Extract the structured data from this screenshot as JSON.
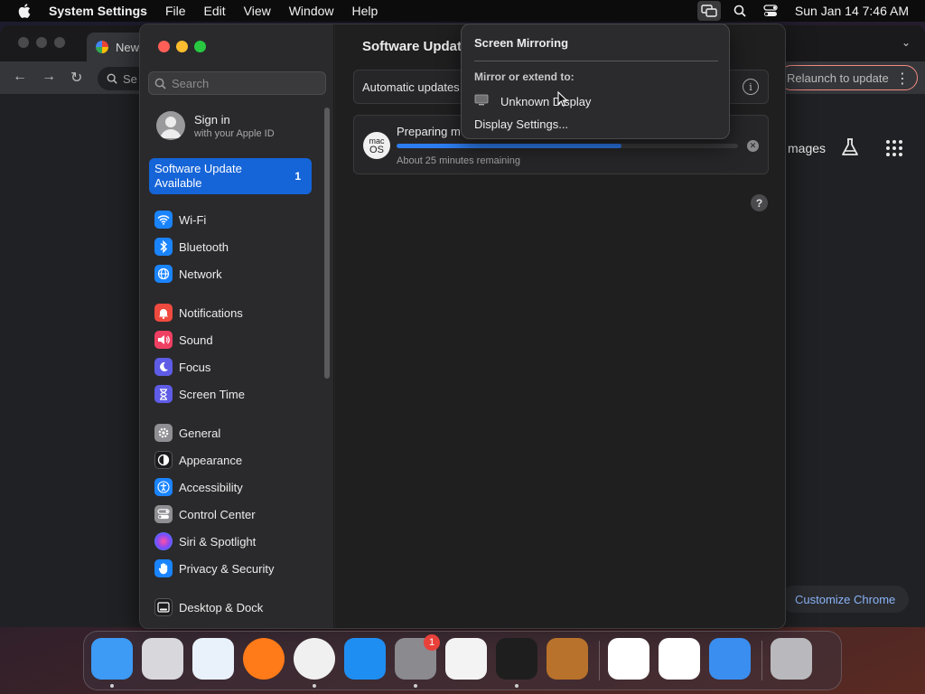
{
  "menubar": {
    "app_name": "System Settings",
    "menus": [
      "File",
      "Edit",
      "View",
      "Window",
      "Help"
    ],
    "clock": "Sun Jan 14  7:46 AM",
    "icons": [
      "screen-mirroring-icon",
      "spotlight-search-icon",
      "control-center-icon"
    ]
  },
  "chrome": {
    "tab_title": "New",
    "omnibox_partial": "Se",
    "relaunch_label": "Relaunch to update",
    "images_link": "mages",
    "customize_label": "Customize Chrome"
  },
  "settings": {
    "search_placeholder": "Search",
    "signin": {
      "title": "Sign in",
      "subtitle": "with your Apple ID"
    },
    "update_item": {
      "label": "Software Update Available",
      "badge": "1"
    },
    "sidebar_groups": [
      [
        {
          "label": "Wi-Fi",
          "icon": "wifi-icon",
          "color": "#1a84ff"
        },
        {
          "label": "Bluetooth",
          "icon": "bluetooth-icon",
          "color": "#1a84ff"
        },
        {
          "label": "Network",
          "icon": "globe-icon",
          "color": "#1a84ff"
        }
      ],
      [
        {
          "label": "Notifications",
          "icon": "bell-icon",
          "color": "#ef4a3f"
        },
        {
          "label": "Sound",
          "icon": "speaker-icon",
          "color": "#ef3f62"
        },
        {
          "label": "Focus",
          "icon": "moon-icon",
          "color": "#5e5ce6"
        },
        {
          "label": "Screen Time",
          "icon": "hourglass-icon",
          "color": "#5e5ce6"
        }
      ],
      [
        {
          "label": "General",
          "icon": "gear-icon",
          "color": "#8e8e93"
        },
        {
          "label": "Appearance",
          "icon": "appearance-icon",
          "color": "#1c1c1e"
        },
        {
          "label": "Accessibility",
          "icon": "accessibility-icon",
          "color": "#1a84ff"
        },
        {
          "label": "Control Center",
          "icon": "control-center-icon",
          "color": "#8e8e93"
        },
        {
          "label": "Siri & Spotlight",
          "icon": "siri-icon",
          "color": "#b03fd6"
        },
        {
          "label": "Privacy & Security",
          "icon": "hand-icon",
          "color": "#1a84ff"
        }
      ],
      [
        {
          "label": "Desktop & Dock",
          "icon": "dock-icon",
          "color": "#1c1c1e"
        }
      ]
    ],
    "main_title": "Software Updat",
    "automatic_updates": "Automatic updates",
    "update_progress": {
      "title": "Preparing m",
      "remaining": "About 25 minutes remaining",
      "fraction": 0.66
    }
  },
  "popover": {
    "title": "Screen Mirroring",
    "subtitle": "Mirror or extend to:",
    "display_name": "Unknown Display",
    "settings_link": "Display Settings..."
  },
  "dock": {
    "apps": [
      {
        "name": "Finder",
        "color": "#3d9af5",
        "running": true
      },
      {
        "name": "Launchpad",
        "color": "#d8d8dc",
        "running": false
      },
      {
        "name": "Safari",
        "color": "#e9f2fb",
        "running": false
      },
      {
        "name": "Firefox",
        "color": "#ff7a18",
        "running": false
      },
      {
        "name": "Chrome",
        "color": "#f0f0f0",
        "running": true
      },
      {
        "name": "App Store",
        "color": "#1f8ef3",
        "running": false
      },
      {
        "name": "System Settings",
        "color": "#8a8a8f",
        "running": true,
        "badge": "1"
      },
      {
        "name": "TextEdit",
        "color": "#f3f3f3",
        "running": false
      },
      {
        "name": "Terminal",
        "color": "#1e1e1e",
        "running": true
      },
      {
        "name": "GarageBand",
        "color": "#b8722b",
        "running": false
      },
      {
        "name": "VS Code",
        "color": "#ffffff",
        "running": false
      },
      {
        "name": "Visual Studio",
        "color": "#ffffff",
        "running": false
      },
      {
        "name": "Weather",
        "color": "#3a8ef0",
        "running": false
      },
      {
        "name": "Trash",
        "color": "#b9b9bd",
        "running": false
      }
    ]
  }
}
